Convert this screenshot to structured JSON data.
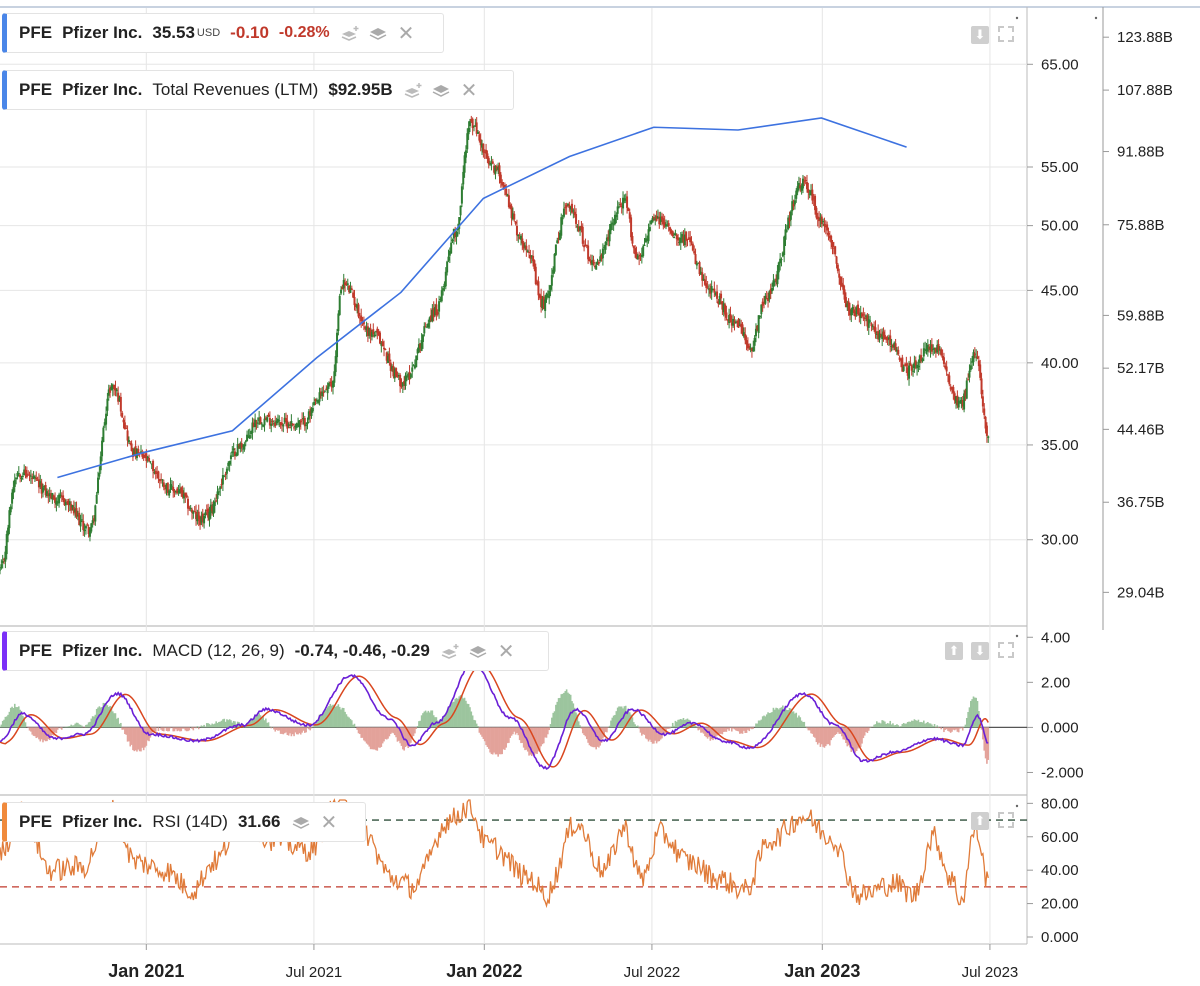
{
  "legends": {
    "price": {
      "symbol": "PFE",
      "name": "Pfizer Inc.",
      "price": "35.53",
      "currency": "USD",
      "change": "-0.10",
      "change_pct": "-0.28%"
    },
    "revenue": {
      "symbol": "PFE",
      "name": "Pfizer Inc.",
      "metric": "Total Revenues (LTM)",
      "value": "$92.95B"
    },
    "macd": {
      "symbol": "PFE",
      "name": "Pfizer Inc.",
      "metric": "MACD (12, 26, 9)",
      "value": "-0.74, -0.46, -0.29"
    },
    "rsi": {
      "symbol": "PFE",
      "name": "Pfizer Inc.",
      "metric": "RSI (14D)",
      "value": "31.66"
    }
  },
  "colors": {
    "up": "#2e7d32",
    "down": "#c0392b",
    "revenue": "#3d72e0",
    "macd_line": "#6a1fd6",
    "signal_line": "#d9461e",
    "rsi": "#e07b39",
    "accent_price": "#4a86e8",
    "accent_macd": "#7b2ff7",
    "accent_rsi": "#f08a3c"
  },
  "icons": [
    "layers-add-icon",
    "layers-icon",
    "close-icon",
    "download-icon",
    "expand-icon",
    "arrow-up-icon"
  ],
  "chart_data": [
    {
      "type": "candlestick",
      "title": "Pfizer Inc. (PFE)",
      "x_ticks": [
        "Jan 2021",
        "Jul 2021",
        "Jan 2022",
        "Jul 2022",
        "Jan 2023",
        "Jul 2023"
      ],
      "y_ticks": [
        "65.00",
        "55.00",
        "50.00",
        "45.00",
        "40.00",
        "35.00",
        "30.00"
      ],
      "y_scale": "log",
      "ylim": [
        26.5,
        71
      ],
      "price_keypoints": [
        [
          "2020-07-27",
          28.5
        ],
        [
          "2020-08-15",
          33.5
        ],
        [
          "2020-10-01",
          32
        ],
        [
          "2020-11-01",
          30.5
        ],
        [
          "2020-11-25",
          38.5
        ],
        [
          "2020-12-20",
          34.5
        ],
        [
          "2021-02-01",
          32.5
        ],
        [
          "2021-03-01",
          31
        ],
        [
          "2021-04-15",
          35
        ],
        [
          "2021-05-01",
          36.5
        ],
        [
          "2021-06-15",
          36.2
        ],
        [
          "2021-07-20",
          38.5
        ],
        [
          "2021-08-01",
          45.5
        ],
        [
          "2021-09-01",
          42
        ],
        [
          "2021-10-05",
          38.8
        ],
        [
          "2021-11-10",
          43.5
        ],
        [
          "2021-12-01",
          49.5
        ],
        [
          "2021-12-17",
          59
        ],
        [
          "2022-01-10",
          55
        ],
        [
          "2022-02-15",
          48.5
        ],
        [
          "2022-03-05",
          44
        ],
        [
          "2022-04-01",
          51.5
        ],
        [
          "2022-05-01",
          47
        ],
        [
          "2022-06-01",
          52
        ],
        [
          "2022-06-15",
          47.5
        ],
        [
          "2022-07-05",
          50.5
        ],
        [
          "2022-08-05",
          49
        ],
        [
          "2022-09-01",
          45
        ],
        [
          "2022-10-01",
          42.5
        ],
        [
          "2022-10-15",
          41
        ],
        [
          "2022-11-01",
          44.5
        ],
        [
          "2022-12-12",
          53.5
        ],
        [
          "2023-01-03",
          50
        ],
        [
          "2023-02-01",
          43.5
        ],
        [
          "2023-03-15",
          41.5
        ],
        [
          "2023-04-01",
          39.5
        ],
        [
          "2023-05-01",
          41
        ],
        [
          "2023-05-31",
          37.5
        ],
        [
          "2023-06-15",
          40.5
        ],
        [
          "2023-06-30",
          35.53
        ]
      ],
      "revenue_axis": {
        "ticks": [
          "123.88B",
          "107.88B",
          "91.88B",
          "75.88B",
          "59.88B",
          "52.17B",
          "44.46B",
          "36.75B",
          "29.04B"
        ]
      },
      "revenue_series": {
        "name": "Total Revenues (LTM)",
        "points": [
          [
            "2020-09-27",
            39.2
          ],
          [
            "2020-12-31",
            41.9
          ],
          [
            "2021-04-04",
            44.3
          ],
          [
            "2021-07-04",
            53.6
          ],
          [
            "2021-10-03",
            63.6
          ],
          [
            "2021-12-31",
            81.3
          ],
          [
            "2022-04-03",
            90.7
          ],
          [
            "2022-07-03",
            97.9
          ],
          [
            "2022-10-02",
            97.2
          ],
          [
            "2022-12-31",
            100.3
          ],
          [
            "2023-04-02",
            92.95
          ]
        ]
      }
    },
    {
      "type": "line",
      "title": "MACD (12, 26, 9)",
      "y_ticks": [
        "4.00",
        "2.00",
        "0.000",
        "-2.000"
      ],
      "ylim": [
        -3,
        4.5
      ],
      "macd_keypoints": [
        [
          "2020-07-27",
          -0.6
        ],
        [
          "2020-08-20",
          0.6
        ],
        [
          "2020-09-25",
          -0.5
        ],
        [
          "2020-10-25",
          -0.3
        ],
        [
          "2020-12-01",
          1.5
        ],
        [
          "2021-01-05",
          -0.3
        ],
        [
          "2021-02-25",
          -0.6
        ],
        [
          "2021-04-15",
          0.1
        ],
        [
          "2021-05-10",
          0.8
        ],
        [
          "2021-06-25",
          0.1
        ],
        [
          "2021-08-10",
          2.3
        ],
        [
          "2021-09-20",
          0.4
        ],
        [
          "2021-10-15",
          -0.8
        ],
        [
          "2021-11-10",
          0.2
        ],
        [
          "2021-12-20",
          2.8
        ],
        [
          "2022-01-30",
          0.4
        ],
        [
          "2022-03-08",
          -1.8
        ],
        [
          "2022-04-10",
          0.8
        ],
        [
          "2022-05-10",
          -0.6
        ],
        [
          "2022-06-10",
          0.8
        ],
        [
          "2022-07-15",
          -0.3
        ],
        [
          "2022-08-15",
          0.2
        ],
        [
          "2022-09-15",
          -0.6
        ],
        [
          "2022-10-15",
          -0.9
        ],
        [
          "2022-12-12",
          1.5
        ],
        [
          "2023-01-15",
          0.1
        ],
        [
          "2023-02-15",
          -1.5
        ],
        [
          "2023-03-20",
          -1.1
        ],
        [
          "2023-05-01",
          -0.5
        ],
        [
          "2023-06-01",
          -0.8
        ],
        [
          "2023-06-18",
          0.5
        ],
        [
          "2023-06-30",
          -0.74
        ]
      ]
    },
    {
      "type": "line",
      "title": "RSI (14D)",
      "y_ticks": [
        "80.00",
        "60.00",
        "40.00",
        "20.00",
        "0.000"
      ],
      "ylim": [
        -3,
        85
      ],
      "thresholds": [
        70,
        30
      ],
      "rsi_keypoints": [
        [
          "2020-07-27",
          50
        ],
        [
          "2020-08-20",
          75
        ],
        [
          "2020-09-20",
          40
        ],
        [
          "2020-10-25",
          42
        ],
        [
          "2020-11-25",
          78
        ],
        [
          "2020-12-20",
          45
        ],
        [
          "2021-01-20",
          40
        ],
        [
          "2021-02-20",
          28
        ],
        [
          "2021-03-15",
          45
        ],
        [
          "2021-04-15",
          70
        ],
        [
          "2021-05-20",
          58
        ],
        [
          "2021-06-25",
          52
        ],
        [
          "2021-07-30",
          82
        ],
        [
          "2021-08-20",
          65
        ],
        [
          "2021-09-25",
          35
        ],
        [
          "2021-10-15",
          30
        ],
        [
          "2021-11-25",
          70
        ],
        [
          "2021-12-15",
          78
        ],
        [
          "2022-01-05",
          55
        ],
        [
          "2022-02-20",
          35
        ],
        [
          "2022-03-08",
          25
        ],
        [
          "2022-04-10",
          68
        ],
        [
          "2022-05-10",
          40
        ],
        [
          "2022-06-01",
          65
        ],
        [
          "2022-06-20",
          35
        ],
        [
          "2022-07-10",
          62
        ],
        [
          "2022-08-10",
          45
        ],
        [
          "2022-09-10",
          35
        ],
        [
          "2022-10-10",
          28
        ],
        [
          "2022-11-05",
          58
        ],
        [
          "2022-12-12",
          72
        ],
        [
          "2023-01-10",
          60
        ],
        [
          "2023-02-10",
          25
        ],
        [
          "2023-03-20",
          32
        ],
        [
          "2023-04-10",
          25
        ],
        [
          "2023-05-01",
          60
        ],
        [
          "2023-05-20",
          35
        ],
        [
          "2023-05-31",
          22
        ],
        [
          "2023-06-15",
          65
        ],
        [
          "2023-06-30",
          31.66
        ]
      ]
    }
  ]
}
